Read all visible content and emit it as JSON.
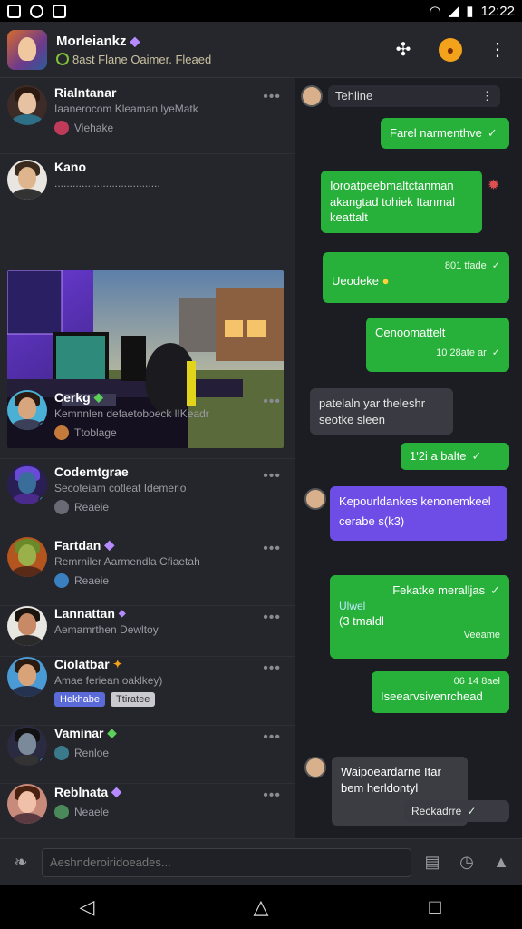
{
  "status": {
    "time": "12:22"
  },
  "header": {
    "title": "Morleiankz",
    "subtitle": "8ast Flane Oaimer. Fleaed"
  },
  "chats": [
    {
      "name": "Rialntanar",
      "preview": "Iaanerocom Kleaman lyeMatk",
      "meta": "Viehake"
    },
    {
      "name": "Kano",
      "preview": "..................................."
    },
    {
      "name": "Cerkg",
      "preview": "Kemnnlen defaetoboeck lIKeadr",
      "meta": "Ttoblage"
    },
    {
      "name": "Codemtgrae",
      "preview": "Secoteiam cotleat Idemerlo",
      "meta": "Reaeie"
    },
    {
      "name": "Fartdan",
      "preview": "Remrniler Aarmendla Cfiaetah",
      "meta": "Reaeie"
    },
    {
      "name": "Lannattan",
      "preview": "Aemamrthen Dewltoy"
    },
    {
      "name": "Ciolatbar",
      "preview": "Amae feriean oaklkey)",
      "chip1": "Hekhabe",
      "chip2": "Ttiratee"
    },
    {
      "name": "Vaminar",
      "meta": "Renloe"
    },
    {
      "name": "Reblnata",
      "meta": "Neaele"
    }
  ],
  "thread": {
    "title": "Tehline",
    "messages": [
      {
        "text": "Farel narmenthve"
      },
      {
        "text": "Ioroatpeebmaltctanman akangtad tohiek Itanmal keattalt"
      },
      {
        "time": "801 tfade",
        "text": "Ueodeke"
      },
      {
        "text": "Cenoomattelt",
        "time": "10 28ate ar"
      },
      {
        "text": "patelaln yar theleshr seotke sleen"
      },
      {
        "text": "1'2i a balte"
      },
      {
        "text": "Kepourldankes kenonemkeel cerabe s(k3)"
      },
      {
        "text": "Fekatke meralljas",
        "sub1": "Ulwel",
        "sub2": "(3 tmaldl",
        "sub3": "Veeame"
      },
      {
        "time": "06 14 8ael",
        "text": "Iseearvsivenrchead"
      },
      {
        "text": "Waipoeardarne Itar bem herldontyl",
        "time": "Reckadrre"
      }
    ]
  },
  "composer": {
    "placeholder": "Aeshnderoiridoeades..."
  },
  "colors": {
    "accent_green": "#27b13a",
    "accent_purple": "#6d4de6",
    "background": "#1f2026"
  }
}
